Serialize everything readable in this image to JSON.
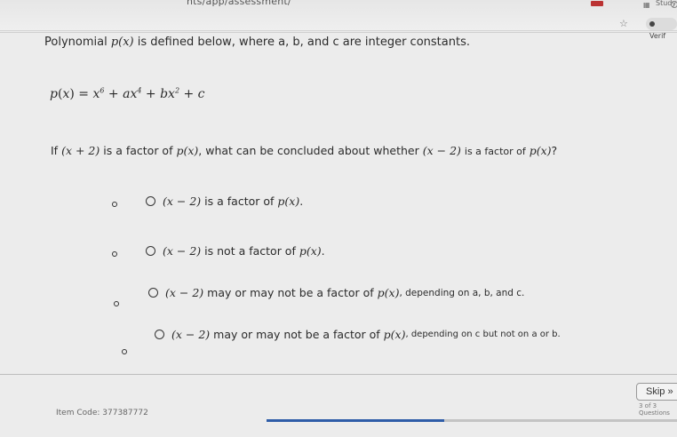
{
  "browser": {
    "url_fragment": "nts/app/assessment/",
    "study_label": "Study",
    "verif_label": "Verif"
  },
  "content": {
    "stem_prefix": "Polynomial",
    "stem_var": "p(x)",
    "stem_suffix": "is defined below, where a, b, and c are integer constants.",
    "equation": "p(x) = x6 + ax4 + bx2 + c",
    "question_prefix": "If",
    "question_factor": "(x + 2)",
    "question_mid": "is a factor of",
    "question_var": "p(x)",
    "question_tail": ", what can be concluded about whether",
    "question_factor2": "(x − 2)",
    "question_end": "is a factor of",
    "question_var2": "p(x)",
    "question_mark": "?"
  },
  "choices": [
    {
      "factor": "(x − 2)",
      "text": "is a factor of",
      "var": "p(x)",
      "end": "."
    },
    {
      "factor": "(x − 2)",
      "text": "is not a factor of",
      "var": "p(x)",
      "end": "."
    },
    {
      "factor": "(x − 2)",
      "text": "may or may not be a factor of",
      "var": "p(x)",
      "end": ", depending on a, b, and c."
    },
    {
      "factor": "(x − 2)",
      "text": "may or may not be a factor of",
      "var": "p(x)",
      "end": ", depending on c but not on a or b."
    }
  ],
  "footer": {
    "item_code": "Item Code: 377387772",
    "skip_label": "Skip »",
    "question_count": "3 of 3 Questions"
  }
}
